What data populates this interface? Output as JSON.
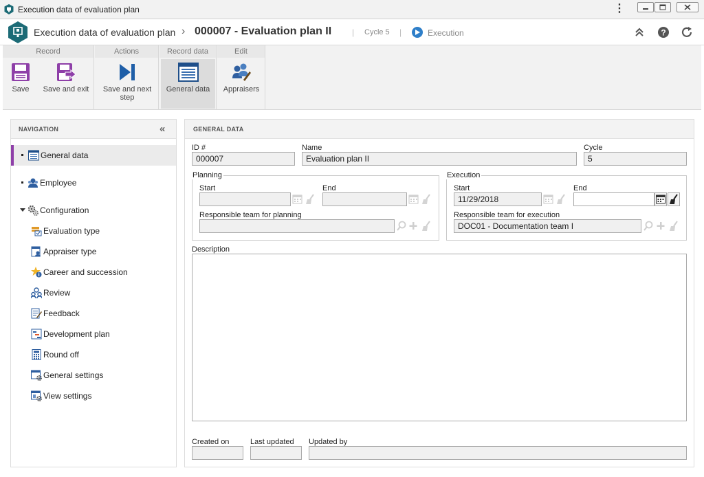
{
  "window": {
    "title": "Execution data of evaluation plan"
  },
  "header": {
    "breadcrumb_root": "Execution data of evaluation plan",
    "breadcrumb_chevron": "›",
    "record_title": "000007 - Evaluation plan II",
    "separator": "|",
    "cycle": "Cycle 5",
    "step": "Execution"
  },
  "ribbon": {
    "groups": [
      {
        "title": "Record",
        "buttons": [
          {
            "label": "Save"
          },
          {
            "label": "Save and exit"
          }
        ]
      },
      {
        "title": "Actions",
        "buttons": [
          {
            "label": "Save and next step"
          }
        ]
      },
      {
        "title": "Record data",
        "buttons": [
          {
            "label": "General data"
          }
        ]
      },
      {
        "title": "Edit",
        "buttons": [
          {
            "label": "Appraisers"
          }
        ]
      }
    ]
  },
  "navigation": {
    "title": "NAVIGATION",
    "items": [
      {
        "label": "General data"
      },
      {
        "label": "Employee"
      },
      {
        "label": "Configuration"
      }
    ],
    "config_items": [
      {
        "label": "Evaluation type"
      },
      {
        "label": "Appraiser type"
      },
      {
        "label": "Career and succession"
      },
      {
        "label": "Review"
      },
      {
        "label": "Feedback"
      },
      {
        "label": "Development plan"
      },
      {
        "label": "Round off"
      },
      {
        "label": "General settings"
      },
      {
        "label": "View settings"
      }
    ]
  },
  "form": {
    "title": "GENERAL DATA",
    "id_label": "ID #",
    "id_value": "000007",
    "name_label": "Name",
    "name_value": "Evaluation plan II",
    "cycle_label": "Cycle",
    "cycle_value": "5",
    "planning": {
      "legend": "Planning",
      "start_label": "Start",
      "start_value": "",
      "end_label": "End",
      "end_value": "",
      "team_label": "Responsible team for planning",
      "team_value": ""
    },
    "execution": {
      "legend": "Execution",
      "start_label": "Start",
      "start_value": "11/29/2018",
      "end_label": "End",
      "end_value": "",
      "team_label": "Responsible team for execution",
      "team_value": "DOC01 - Documentation team I"
    },
    "description_label": "Description",
    "description_value": "",
    "created_on_label": "Created on",
    "last_updated_label": "Last updated",
    "updated_by_label": "Updated by"
  },
  "colors": {
    "accent": "#8e3fa8",
    "brand": "#1c6b76",
    "execution_step": "#2f7fc9"
  }
}
